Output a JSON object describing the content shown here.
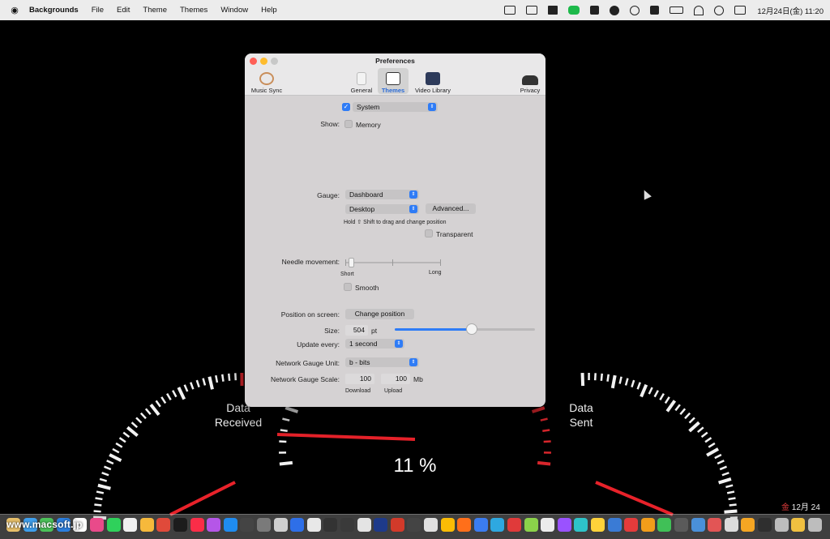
{
  "menubar": {
    "apple": "",
    "items": [
      "Backgrounds",
      "File",
      "Edit",
      "Theme",
      "Themes",
      "Window",
      "Help"
    ],
    "clock": "12月24日(金) 11:20",
    "status_icons": [
      "text-input-icon",
      "screen-icon",
      "dropbox-icon",
      "line-icon",
      "sync-icon",
      "cloud-icon",
      "play-icon",
      "font-icon",
      "battery-icon",
      "wifi-icon",
      "search-icon",
      "control-center-icon"
    ]
  },
  "window": {
    "title": "Preferences",
    "toolbar": [
      {
        "label": "Music Sync",
        "icon": "music-sync-icon"
      },
      {
        "label": "General",
        "icon": "general-icon"
      },
      {
        "label": "Themes",
        "icon": "themes-icon",
        "active": true
      },
      {
        "label": "Video Library",
        "icon": "video-library-icon"
      },
      {
        "label": "Privacy",
        "icon": "privacy-icon"
      }
    ],
    "theme_select": "System",
    "show_label": "Show:",
    "show_memory": "Memory",
    "gauge_label": "Gauge:",
    "gauge_select": "Dashboard",
    "placement_select": "Desktop",
    "advanced_button": "Advanced...",
    "hold_hint": "Hold ⇧ Shift to drag and change position",
    "transparent_label": "Transparent",
    "needle_label": "Needle movement:",
    "needle_short": "Short",
    "needle_long": "Long",
    "needle_level": 0.04,
    "smooth_label": "Smooth",
    "position_label": "Position on screen:",
    "change_position_button": "Change position",
    "size_label": "Size:",
    "size_value": "504",
    "size_unit": "pt",
    "size_level": 0.55,
    "update_label": "Update every:",
    "update_select": "1 second",
    "net_unit_label": "Network Gauge Unit:",
    "net_unit_select": "b - bits",
    "net_scale_label": "Network Gauge Scale:",
    "download_value": "100",
    "upload_value": "100",
    "scale_unit": "Mb",
    "download_label": "Download",
    "upload_label": "Upload"
  },
  "gauges": {
    "left_label_1": "Data",
    "left_label_2": "Received",
    "right_label_1": "Data",
    "right_label_2": "Sent",
    "center_value": "11 %"
  },
  "desktop": {
    "date_kanji": "金",
    "date_text": "12月 24",
    "watermark": "www.macsoft.jp"
  },
  "dock": {
    "colors": [
      "#e8c06a",
      "#3fa0ee",
      "#4cc35a",
      "#2b7fe0",
      "#ffffff",
      "#e94a8a",
      "#2fd15b",
      "#f0f0f0",
      "#f6b93b",
      "#e04a3a",
      "#1c1c1c",
      "#fa2d48",
      "#b556e8",
      "#1f8cf0",
      "#444444",
      "#7a7a7a",
      "#d0d0d0",
      "#2e6fe8",
      "#e8e8e8",
      "#333333",
      "#3a3a3a",
      "#e4e4e4",
      "#1e3a8a",
      "#d23a2a",
      "#444444",
      "#e0e0e0",
      "#fbbc05",
      "#ff6f1a",
      "#3b7cf0",
      "#2ea8e0",
      "#e03a3a",
      "#8bd24a",
      "#ececec",
      "#9a52ff",
      "#2ec3c9",
      "#ffd23a",
      "#3a7bd5",
      "#e43b3b",
      "#f29d1a",
      "#40c057",
      "#5a5a5a",
      "#4a90d9",
      "#e25555",
      "#dcdcdc",
      "#f5a623",
      "#2f2f2f",
      "#bdbdbd",
      "#f0c040",
      "#bdbdbd"
    ]
  }
}
